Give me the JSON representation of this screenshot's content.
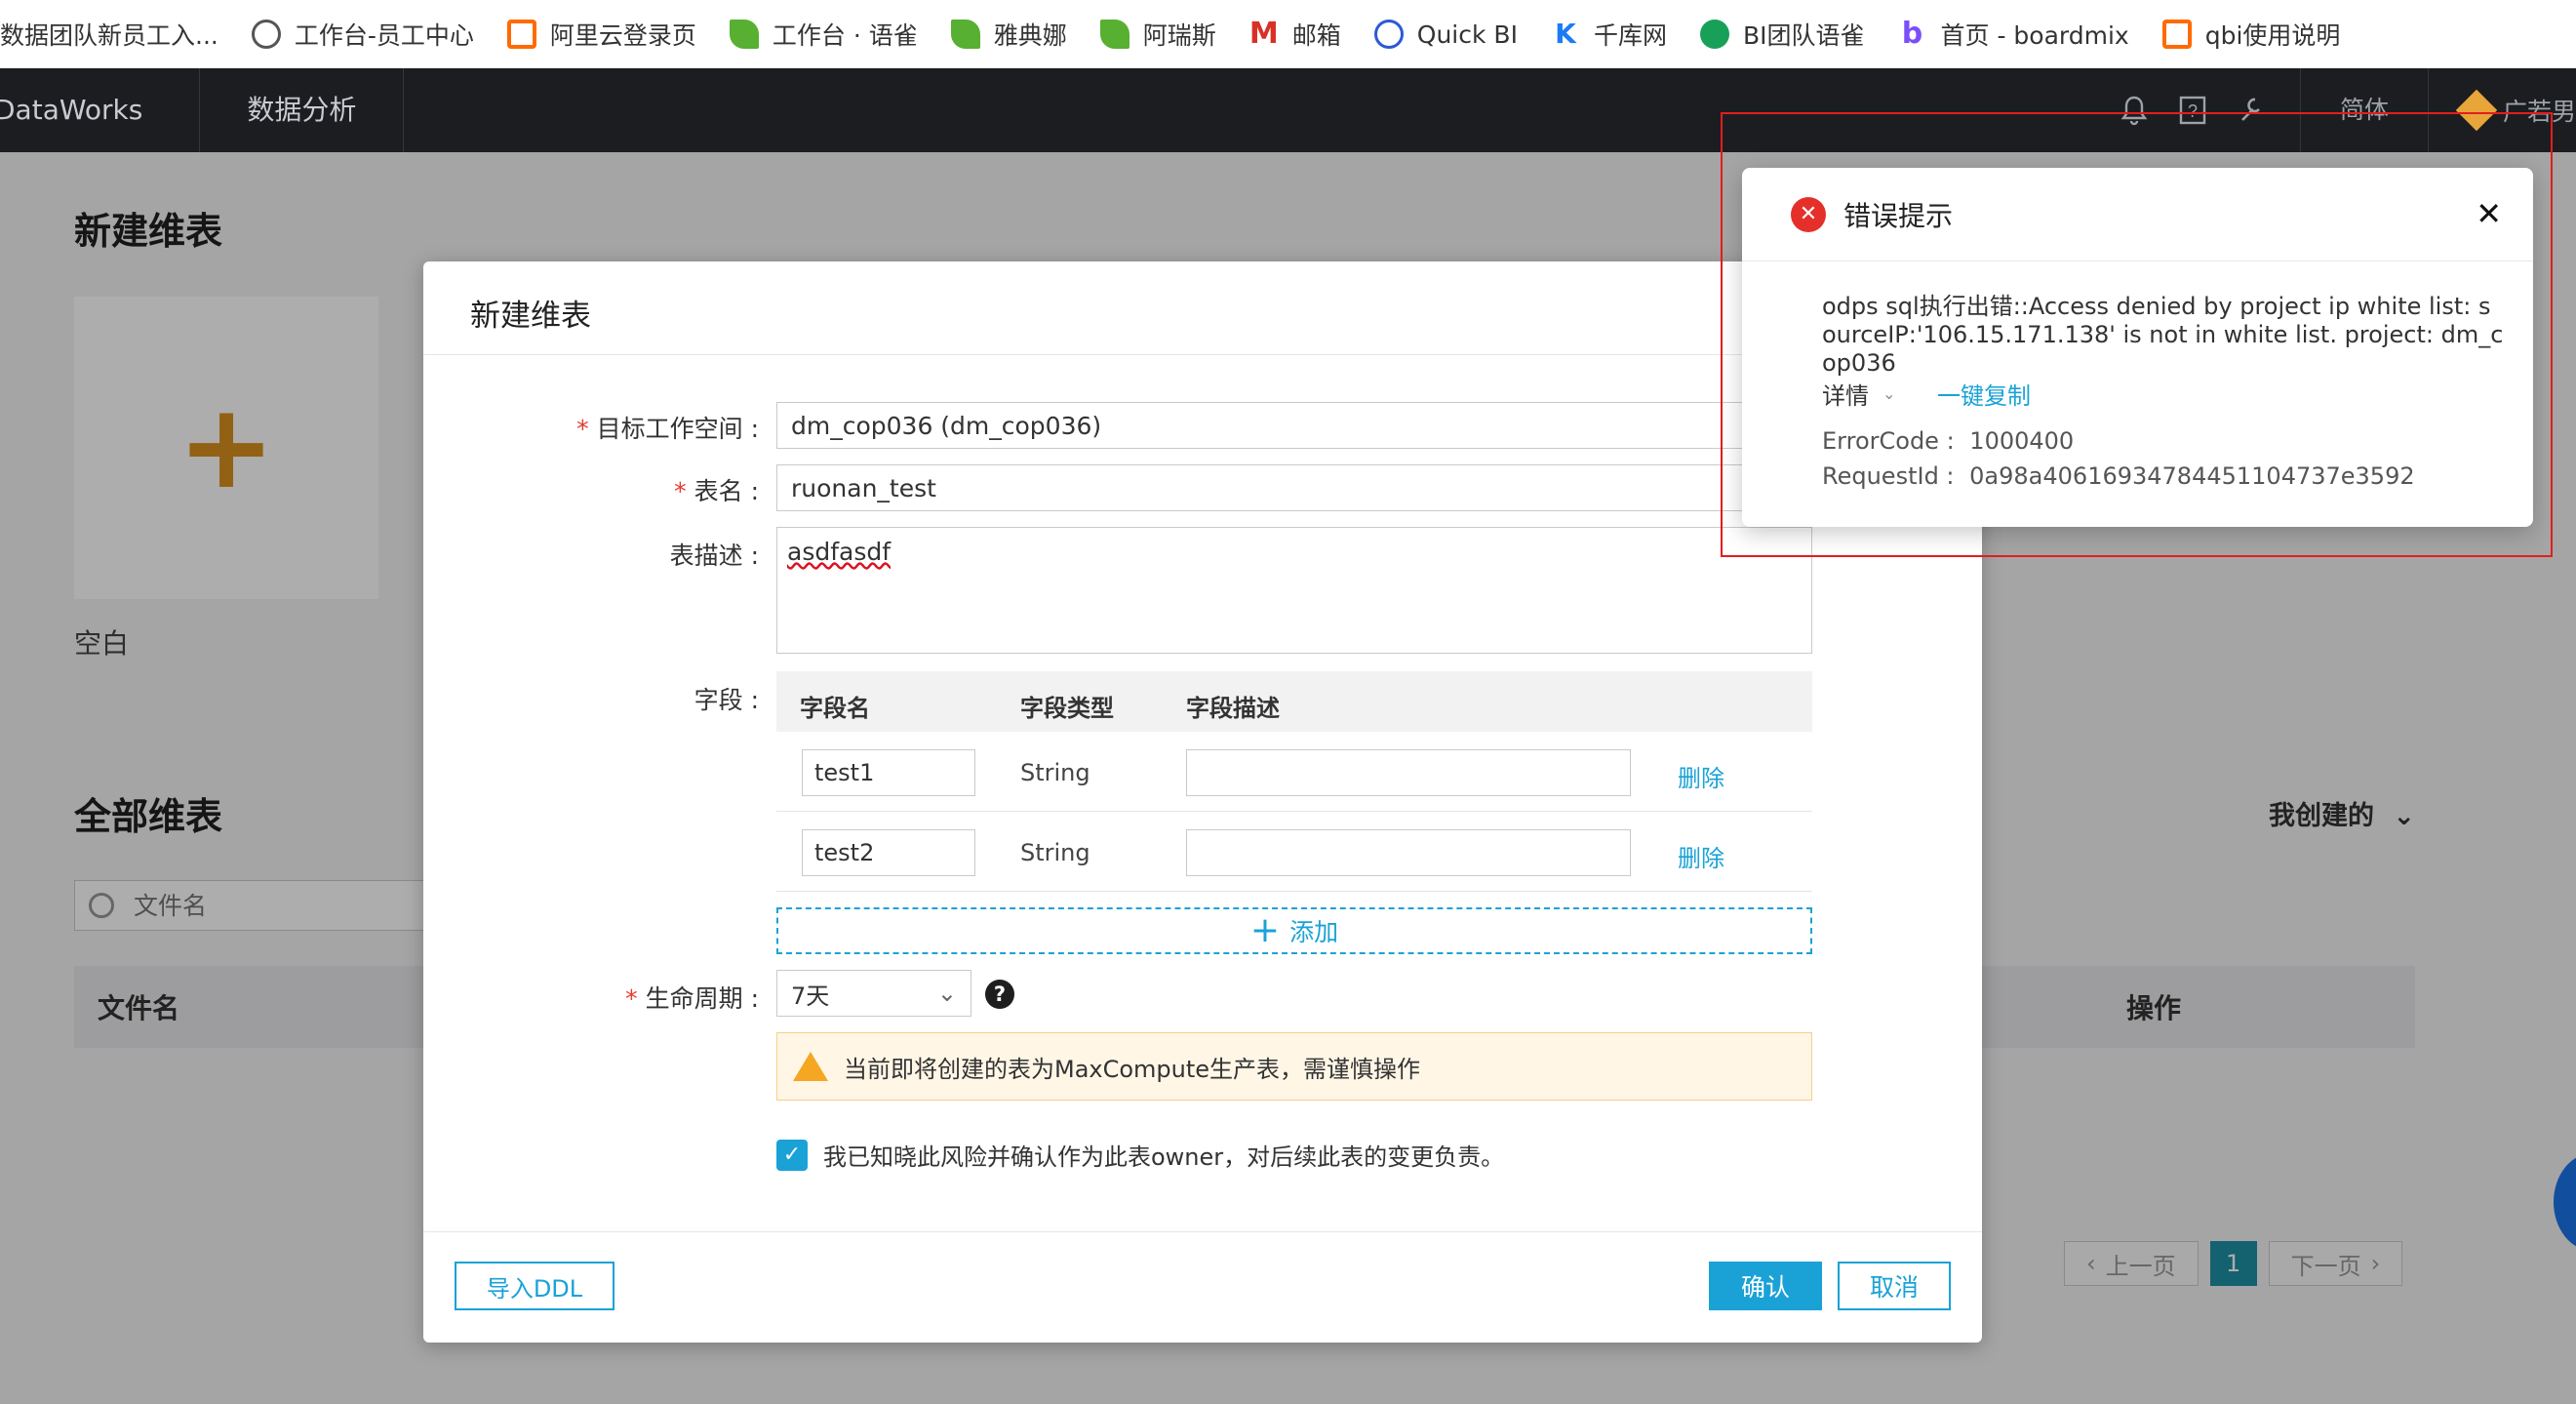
{
  "bookmarks": [
    {
      "label": "数据团队新员工入...",
      "icon": "none"
    },
    {
      "label": "工作台-员工中心",
      "icon": "globe-icon"
    },
    {
      "label": "阿里云登录页",
      "icon": "aliyun-icon"
    },
    {
      "label": "工作台 · 语雀",
      "icon": "yuque-icon"
    },
    {
      "label": "雅典娜",
      "icon": "leaf-icon"
    },
    {
      "label": "阿瑞斯",
      "icon": "leaf-icon"
    },
    {
      "label": "邮箱",
      "icon": "mail-icon"
    },
    {
      "label": "Quick BI",
      "icon": "quickbi-icon"
    },
    {
      "label": "千库网",
      "icon": "qianku-icon"
    },
    {
      "label": "BI团队语雀",
      "icon": "tree-icon"
    },
    {
      "label": "首页 - boardmix",
      "icon": "boardmix-icon"
    },
    {
      "label": "qbi使用说明",
      "icon": "aliyun-icon"
    }
  ],
  "topnav": {
    "brand": "DataWorks",
    "tab": "数据分析",
    "lang": "简体",
    "user": "广若男"
  },
  "page": {
    "new_section_title": "新建维表",
    "blank_label": "空白",
    "all_section_title": "全部维表",
    "mine_filter": "我创建的",
    "search_placeholder": "文件名",
    "col_file": "文件名",
    "col_op": "操作",
    "pager": {
      "prev": "上一页",
      "current": "1",
      "next": "下一页"
    }
  },
  "modal": {
    "title": "新建维表",
    "workspace_label": "目标工作空间 :",
    "workspace_value": "dm_cop036 (dm_cop036)",
    "table_name_label": "表名 :",
    "table_name_value": "ruonan_test",
    "desc_label": "表描述 :",
    "desc_value": "asdfasdf",
    "fields_label": "字段 :",
    "fields_headers": {
      "name": "字段名",
      "type": "字段类型",
      "desc": "字段描述"
    },
    "fields": [
      {
        "name": "test1",
        "type": "String",
        "delete": "删除"
      },
      {
        "name": "test2",
        "type": "String",
        "delete": "删除"
      }
    ],
    "add_label": "添加",
    "lifecycle_label": "生命周期 :",
    "lifecycle_value": "7天",
    "warning": "当前即将创建的表为MaxCompute生产表，需谨慎操作",
    "confirm_text": "我已知晓此风险并确认作为此表owner，对后续此表的变更负责。",
    "confirm_checked": true,
    "import_ddl": "导入DDL",
    "ok": "确认",
    "cancel": "取消"
  },
  "error": {
    "title": "错误提示",
    "message": "odps sql执行出错::Access denied by project ip white list: sourceIP:'106.15.171.138' is not in white list. project: dm_cop036",
    "detail": "详情",
    "copy": "一键复制",
    "error_code_label": "ErrorCode :",
    "error_code": "1000400",
    "request_id_label": "RequestId :",
    "request_id": "0a98a40616934784451104737e3592"
  },
  "colors": {
    "accent": "#1aa2d6",
    "danger": "#e5302a",
    "nav_bg": "#1c1d21"
  }
}
